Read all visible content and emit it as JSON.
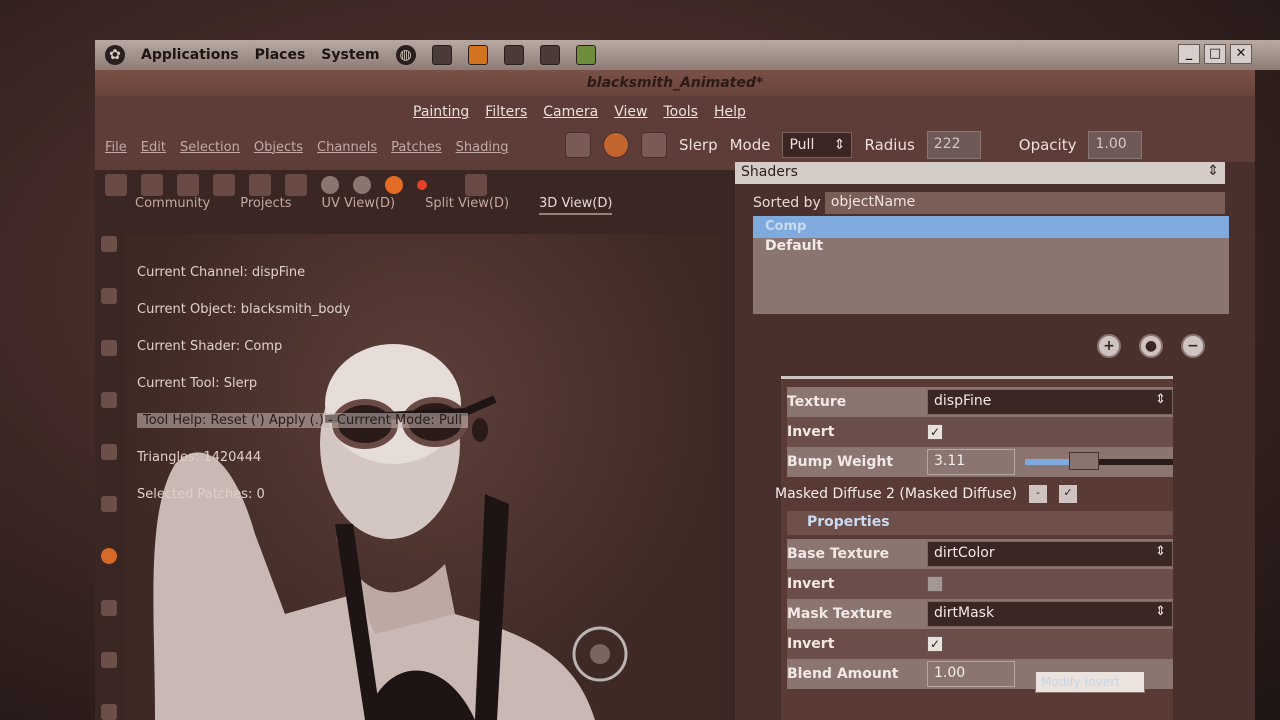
{
  "gnome_panel": {
    "menus": [
      "Applications",
      "Places",
      "System"
    ]
  },
  "window": {
    "title": "blacksmith_Animated*",
    "controls": [
      "_",
      "□",
      "✕"
    ]
  },
  "menubar": {
    "faded_items": [
      "File",
      "Edit",
      "Selection",
      "Objects",
      "Channels",
      "Patches",
      "Shading"
    ],
    "items": [
      "Painting",
      "Filters",
      "Camera",
      "View",
      "Tools",
      "Help"
    ]
  },
  "toolbar": {
    "tool_name": "Slerp",
    "mode_label": "Mode",
    "mode_value": "Pull",
    "radius_label": "Radius",
    "radius_value": "222",
    "opacity_label": "Opacity",
    "opacity_value": "1.00"
  },
  "view_tabs": [
    "Community",
    "Projects",
    "UV View(D)",
    "Split View(D)",
    "3D View(D)"
  ],
  "viewport_info": {
    "current_channel": "Current Channel: dispFine",
    "current_object": "Current Object: blacksmith_body",
    "current_shader": "Current Shader: Comp",
    "current_tool": "Current Tool: Slerp",
    "tool_help": "Tool Help: Reset (')   Apply (.)   - Currrent Mode: Pull",
    "triangles": "Triangles: 1420444",
    "selected_patches": "Selected Patches: 0"
  },
  "shaders_panel": {
    "header": "Shaders",
    "sorted_by_label": "Sorted by",
    "sorted_by_value": "objectName",
    "list_selected": "Comp",
    "list_items": [
      "Default"
    ]
  },
  "properties": {
    "texture_label": "Texture",
    "texture_value": "dispFine",
    "invert_label": "Invert",
    "bump_label": "Bump Weight",
    "bump_value": "3.11",
    "bump_fraction": 0.36,
    "masked_section": "Masked Diffuse 2 (Masked Diffuse)",
    "properties_head": "Properties",
    "base_texture_label": "Base Texture",
    "base_texture_value": "dirtColor",
    "invert2_label": "Invert",
    "mask_texture_label": "Mask Texture",
    "mask_texture_value": "dirtMask",
    "invert3_label": "Invert",
    "blend_label": "Blend Amount",
    "blend_value": "1.00",
    "tooltip": "Modify Invert"
  },
  "colors": {
    "accent_blue": "#7faadd",
    "active_orange": "#e46b24",
    "panel_bg": "#4a302c"
  }
}
